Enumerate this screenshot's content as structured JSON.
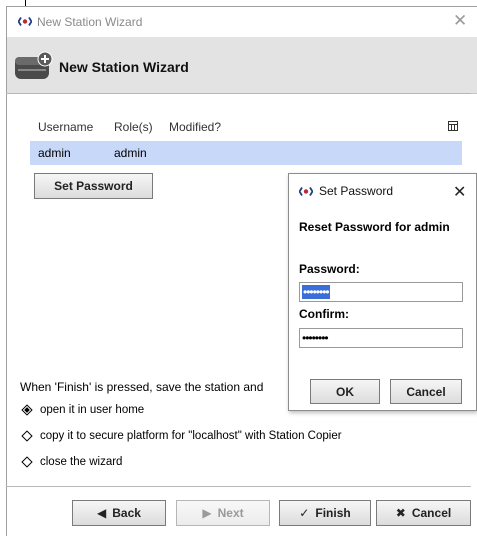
{
  "window": {
    "title": "New Station Wizard",
    "close_glyph": "✕"
  },
  "header": {
    "title": "New Station Wizard",
    "icon": "station-wizard-icon"
  },
  "table": {
    "columns": [
      "Username",
      "Role(s)",
      "Modified?"
    ],
    "config_icon": "table-options-icon",
    "rows": [
      {
        "username": "admin",
        "roles": "admin",
        "modified": ""
      }
    ]
  },
  "set_password_button": "Set Password",
  "finish_text": "When 'Finish' is pressed, save the station and",
  "options": [
    {
      "label": "open it in user home",
      "selected": true
    },
    {
      "label": "copy it to secure platform for \"localhost\" with Station Copier",
      "selected": false
    },
    {
      "label": "close the wizard",
      "selected": false
    }
  ],
  "buttons": {
    "back": "Back",
    "next": "Next",
    "finish": "Finish",
    "cancel": "Cancel"
  },
  "dialog": {
    "title": "Set Password",
    "close_glyph": "✕",
    "heading": "Reset Password for admin",
    "password_label": "Password:",
    "password_value": "••••••••",
    "confirm_label": "Confirm:",
    "confirm_value": "••••••••",
    "ok": "OK",
    "cancel": "Cancel"
  },
  "colors": {
    "selection_row": "#c8d8f8",
    "selection_text": "#3a6ed8",
    "header_bg": "#e3e3e3"
  }
}
